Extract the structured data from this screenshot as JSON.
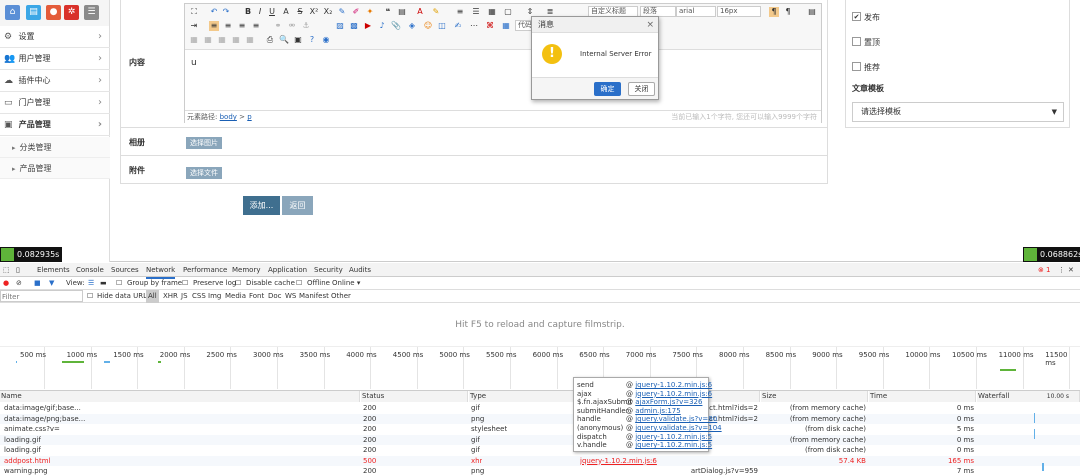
{
  "topbar": {
    "icons": [
      "home-icon",
      "file-icon",
      "user-icon",
      "gear-icon",
      "list-icon"
    ]
  },
  "sidebar": {
    "items": [
      {
        "label": "设置",
        "icon": "settings-icon"
      },
      {
        "label": "用户管理",
        "icon": "users-icon"
      },
      {
        "label": "插件中心",
        "icon": "cloud-icon"
      },
      {
        "label": "门户管理",
        "icon": "portal-icon"
      },
      {
        "label": "产品管理",
        "icon": "products-icon"
      }
    ],
    "subitems": [
      {
        "label": "分类管理"
      },
      {
        "label": "产品管理"
      }
    ]
  },
  "form": {
    "content_label": "内容",
    "album_label": "相册",
    "attachment_label": "附件",
    "select_image": "选择图片",
    "select_file": "选择文件",
    "add_button": "添加...",
    "back_button": "返回"
  },
  "editor": {
    "code_label": "代码",
    "custom_title": "自定义标题",
    "paragraph": "段落",
    "font": "arial",
    "font_size": "16px",
    "body_text": "u",
    "path_label": "元素路径:",
    "path_body": "body",
    "path_sep": ">",
    "path_p": "p",
    "count_text": "当前已输入1个字符, 您还可以输入9999个字符"
  },
  "right_panel": {
    "publish": "发布",
    "top": "置顶",
    "recommend": "推荐",
    "template_label": "文章模板",
    "template_select": "请选择模板"
  },
  "dialog": {
    "title": "消息",
    "close": "×",
    "message": "Internal Server Error",
    "ok": "确定",
    "close_button": "关闭"
  },
  "timers": {
    "left": "0.082935s",
    "right": "0.068862s"
  },
  "devtools": {
    "tabs": [
      "Elements",
      "Console",
      "Sources",
      "Network",
      "Performance",
      "Memory",
      "Application",
      "Security",
      "Audits"
    ],
    "error_count": "1",
    "toolbar": {
      "view": "View:",
      "group_by_frame": "Group by frame",
      "preserve_log": "Preserve log",
      "disable_cache": "Disable cache",
      "offline": "Offline",
      "online": "Online"
    },
    "filter": {
      "placeholder": "Filter",
      "hide_data_urls": "Hide data URLs",
      "types": [
        "All",
        "XHR",
        "JS",
        "CSS",
        "Img",
        "Media",
        "Font",
        "Doc",
        "WS",
        "Manifest",
        "Other"
      ]
    },
    "hint": "Hit F5 to reload and capture filmstrip.",
    "timeline_ticks": [
      "500 ms",
      "1000 ms",
      "1500 ms",
      "2000 ms",
      "2500 ms",
      "3000 ms",
      "3500 ms",
      "4000 ms",
      "4500 ms",
      "5000 ms",
      "5500 ms",
      "6000 ms",
      "6500 ms",
      "7000 ms",
      "7500 ms",
      "8000 ms",
      "8500 ms",
      "9000 ms",
      "9500 ms",
      "10000 ms",
      "10500 ms",
      "11000 ms",
      "11500 ms"
    ],
    "columns": [
      "Name",
      "Status",
      "Type",
      "Initiator",
      "Size",
      "Time",
      "Waterfall"
    ],
    "waterfall_scale": "10.00 s",
    "rows": [
      {
        "name": "data:image/gif;base...",
        "status": "200",
        "type": "gif",
        "initiator": "ect.html?ids=2",
        "size": "(from memory cache)",
        "time": "0 ms",
        "error": false
      },
      {
        "name": "data:image/png;base...",
        "status": "200",
        "type": "png",
        "initiator": "ect.html?ids=2",
        "size": "(from memory cache)",
        "time": "0 ms",
        "error": false
      },
      {
        "name": "animate.css?v=",
        "status": "200",
        "type": "stylesheet",
        "initiator": "",
        "size": "(from disk cache)",
        "time": "5 ms",
        "error": false
      },
      {
        "name": "loading.gif",
        "status": "200",
        "type": "gif",
        "initiator": "",
        "size": "(from memory cache)",
        "time": "0 ms",
        "error": false
      },
      {
        "name": "loading.gif",
        "status": "200",
        "type": "gif",
        "initiator": "",
        "size": "(from disk cache)",
        "time": "0 ms",
        "error": false
      },
      {
        "name": "addpost.html",
        "status": "500",
        "type": "xhr",
        "initiator": "jquery-1.10.2.min.js:6",
        "size": "57.4 KB",
        "time": "165 ms",
        "error": true
      },
      {
        "name": "warning.png",
        "status": "200",
        "type": "png",
        "initiator": "artDialog.js?v=959",
        "size": "",
        "time": "7 ms",
        "error": false
      }
    ],
    "callstack": [
      {
        "fn": "send",
        "link": "jquery-1.10.2.min.js:6"
      },
      {
        "fn": "ajax",
        "link": "jquery-1.10.2.min.js:6"
      },
      {
        "fn": "$.fn.ajaxSubmit",
        "link": "ajaxForm.js?v=326"
      },
      {
        "fn": "submitHandler",
        "link": "admin.js:175"
      },
      {
        "fn": "handle",
        "link": "jquery.validate.js?v=80"
      },
      {
        "fn": "(anonymous)",
        "link": "jquery.validate.js?v=104"
      },
      {
        "fn": "dispatch",
        "link": "jquery-1.10.2.min.js:5"
      },
      {
        "fn": "v.handle",
        "link": "jquery-1.10.2.min.js:5"
      }
    ]
  }
}
